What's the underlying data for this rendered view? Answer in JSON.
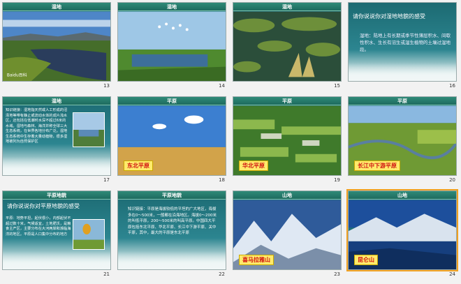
{
  "slides": [
    {
      "num": "13",
      "title": "湿地",
      "type": "photo",
      "photo": "wetland-grass",
      "watermark": "Baidu百科"
    },
    {
      "num": "14",
      "title": "湿地",
      "type": "photo",
      "photo": "wetland-birds"
    },
    {
      "num": "15",
      "title": "湿地",
      "type": "photo",
      "photo": "wetland-marsh"
    },
    {
      "num": "16",
      "title": "湿地",
      "type": "question",
      "question": "请你说说你对湿地地貌的感受",
      "definition": "湿地：陆地上有长期或季节性薄层积水、间歇性积水、生长有沼生或湿生植物的土壤过湿地段。"
    },
    {
      "num": "17",
      "title": "湿地",
      "type": "text",
      "text": "知识链接：湿地指天然或人工形成的沼泽地等带有静止或流动水体的成片浅水区，还包括在低潮时水深不超过6米的水域。湿地与森林、海洋并称全球三大生态系统，在世界各地分布广泛。湿地生态系统中生存着大量动植物，很多湿地被列为自然保护区"
    },
    {
      "num": "18",
      "title": "平原",
      "type": "photo",
      "photo": "wheat-field",
      "caption": "东北平原"
    },
    {
      "num": "19",
      "title": "平原",
      "type": "photo",
      "photo": "farm-village",
      "caption": "华北平原"
    },
    {
      "num": "20",
      "title": "平原",
      "type": "photo",
      "photo": "river-plain",
      "caption": "长江中下游平原"
    },
    {
      "num": "21",
      "title": "平原地貌",
      "type": "question2",
      "question": "请你说说你对平原地貌的感受",
      "text": "平原：地势平坦，起伏很小，内部起伏不超过数十米，气候适宜，土地肥沃，是粮食主产区，主要分布在大河两岸和濒临海洋的地区。平原是人口集中分布的地方"
    },
    {
      "num": "22",
      "title": "平原地貌",
      "type": "text2",
      "text": "知识链接：平原是海拔较低的平坦的广大地区，海拔多在0～500米，一般都在沿海地区。海拔0～200米的叫低平原，200～500米的叫高平原。中国四大平原包括东北平原、华北平原、长江中下游平原、关中平原，其中，最大的平原是东北平原"
    },
    {
      "num": "23",
      "title": "山地",
      "type": "photo",
      "photo": "snow-mountains",
      "caption": "喜马拉雅山"
    },
    {
      "num": "24",
      "title": "山地",
      "type": "photo",
      "photo": "lake-mountains",
      "caption": "昆仑山"
    }
  ]
}
